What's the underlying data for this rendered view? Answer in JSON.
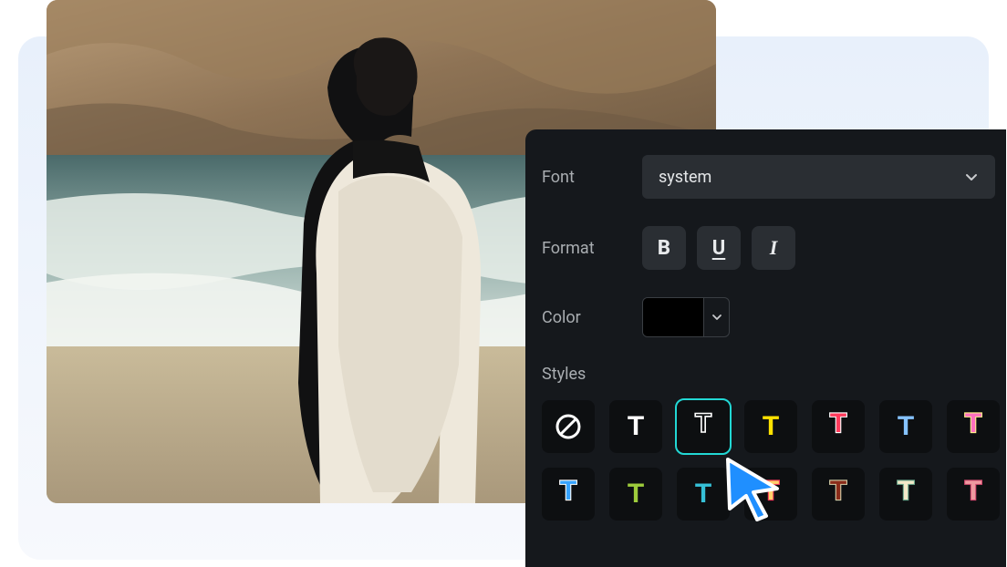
{
  "panel": {
    "font_label": "Font",
    "font_value": "system",
    "format_label": "Format",
    "bold_glyph": "B",
    "underline_glyph": "U",
    "italic_glyph": "I",
    "color_label": "Color",
    "color_value": "#000000",
    "styles_label": "Styles",
    "styles": {
      "row1": [
        {
          "type": "none"
        },
        {
          "type": "solid",
          "fill": "#ffffff"
        },
        {
          "type": "outline",
          "fill": "none",
          "stroke": "#ffffff",
          "selected": true
        },
        {
          "type": "solid",
          "fill": "#ffe200"
        },
        {
          "type": "outline",
          "fill": "#ff3b5c",
          "stroke": "#ffffff"
        },
        {
          "type": "solid",
          "fill": "#86c3ff"
        },
        {
          "type": "outline",
          "fill": "#ff6fbf",
          "stroke": "#fff08a"
        }
      ],
      "row2": [
        {
          "type": "outline",
          "fill": "#36a3ff",
          "stroke": "#ffffff"
        },
        {
          "type": "solid",
          "fill": "#9ecc3c"
        },
        {
          "type": "solid",
          "fill": "#36c1d8"
        },
        {
          "type": "outline",
          "fill": "#ffd06a",
          "stroke": "#ff3b5c"
        },
        {
          "type": "outline",
          "fill": "#8a2c1a",
          "stroke": "#d6cfa8"
        },
        {
          "type": "outline",
          "fill": "#f2e9c9",
          "stroke": "#6aa88c"
        },
        {
          "type": "outline",
          "fill": "#ef9aa0",
          "stroke": "#d64a70"
        }
      ]
    }
  }
}
